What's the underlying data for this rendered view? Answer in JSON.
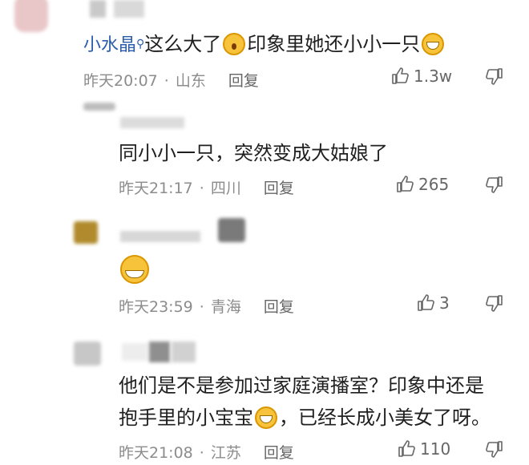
{
  "comments": [
    {
      "author": "小水晶",
      "text_parts": [
        "这么大了",
        "印象里她还小小一只"
      ],
      "time": "昨天20:07",
      "location": "山东",
      "reply_label": "回复",
      "likes": "1.3w"
    },
    {
      "author": "",
      "text": "同小小一只，突然变成大姑娘了",
      "time": "昨天21:17",
      "location": "四川",
      "reply_label": "回复",
      "likes": "265"
    },
    {
      "author": "",
      "text": "",
      "time": "昨天23:59",
      "location": "青海",
      "reply_label": "回复",
      "likes": "3"
    },
    {
      "author": "",
      "text_line1": "他们是不是参加过家庭演播室？印象中还是",
      "text_line2_parts": [
        "抱手里的小宝宝",
        "，已经长成小美女了呀。"
      ],
      "time": "昨天21:08",
      "location": "江苏",
      "reply_label": "回复",
      "likes": "110"
    }
  ],
  "icons": [
    "search-icon",
    "thumbs-up-icon",
    "thumbs-down-icon",
    "grin-emoji-icon",
    "surprised-emoji-icon"
  ]
}
